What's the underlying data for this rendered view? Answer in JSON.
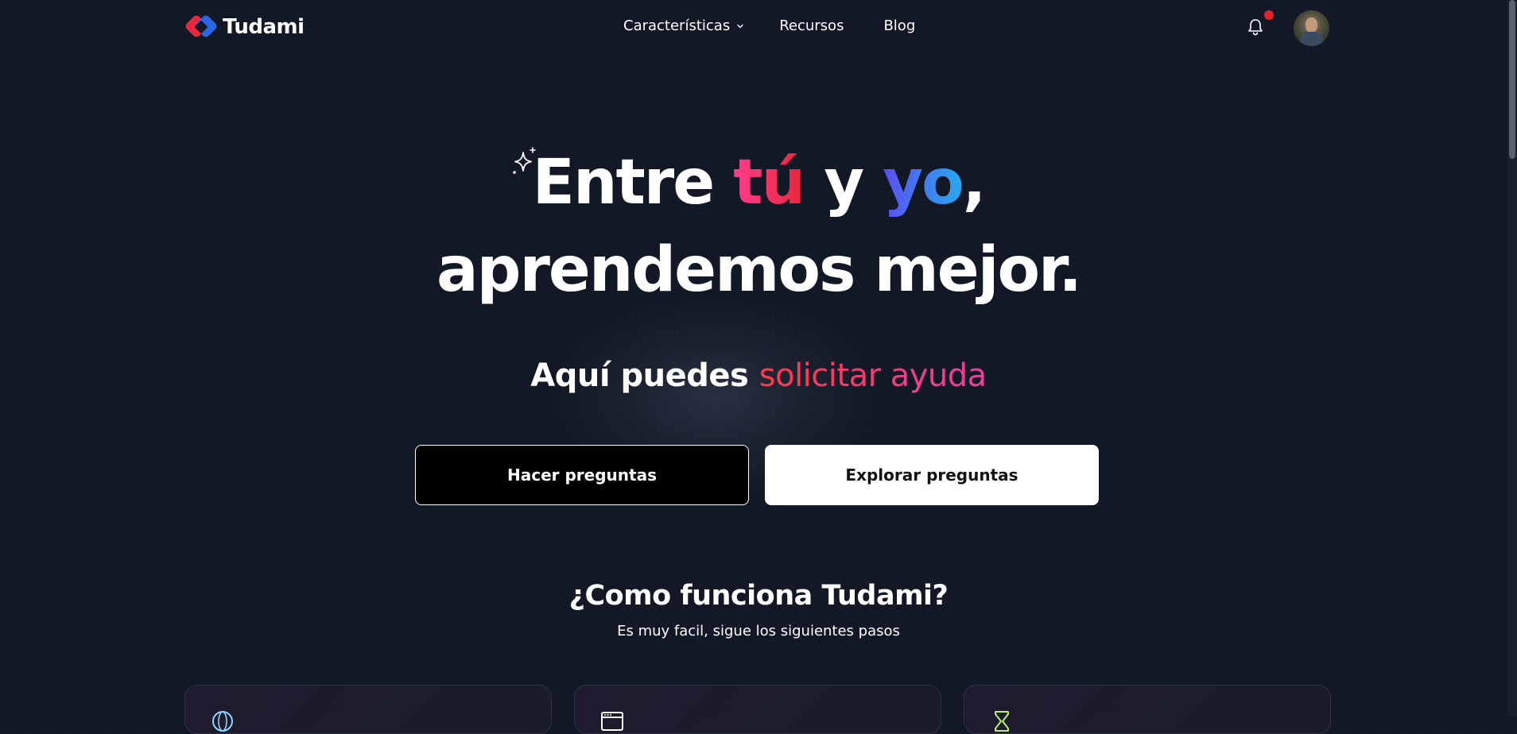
{
  "header": {
    "brand": "Tudami",
    "nav": [
      {
        "label": "Características",
        "has_dropdown": true
      },
      {
        "label": "Recursos"
      },
      {
        "label": "Blog"
      }
    ],
    "notification_icon": "bell-icon",
    "has_unread_notification": true,
    "notification_dot_color": "#e5222f"
  },
  "hero": {
    "title_line1": {
      "pre": "Entre ",
      "tu": "tú",
      "mid": " y ",
      "yo": "yo",
      "post": ","
    },
    "title_line2": "aprendemos mejor.",
    "subtitle_lead": "Aquí puedes",
    "subtitle_accent": "solicitar ayuda",
    "primary_button": "Hacer preguntas",
    "secondary_button": "Explorar preguntas"
  },
  "how_it_works": {
    "title": "¿Como funciona Tudami?",
    "subtitle": "Es muy facil, sigue los siguientes pasos"
  },
  "colors": {
    "background": "#121826",
    "accent_red": "#e8263c",
    "accent_pink": "#ff3d8b",
    "accent_blue": "#2aa8f0",
    "accent_violet": "#5b4ef0"
  }
}
